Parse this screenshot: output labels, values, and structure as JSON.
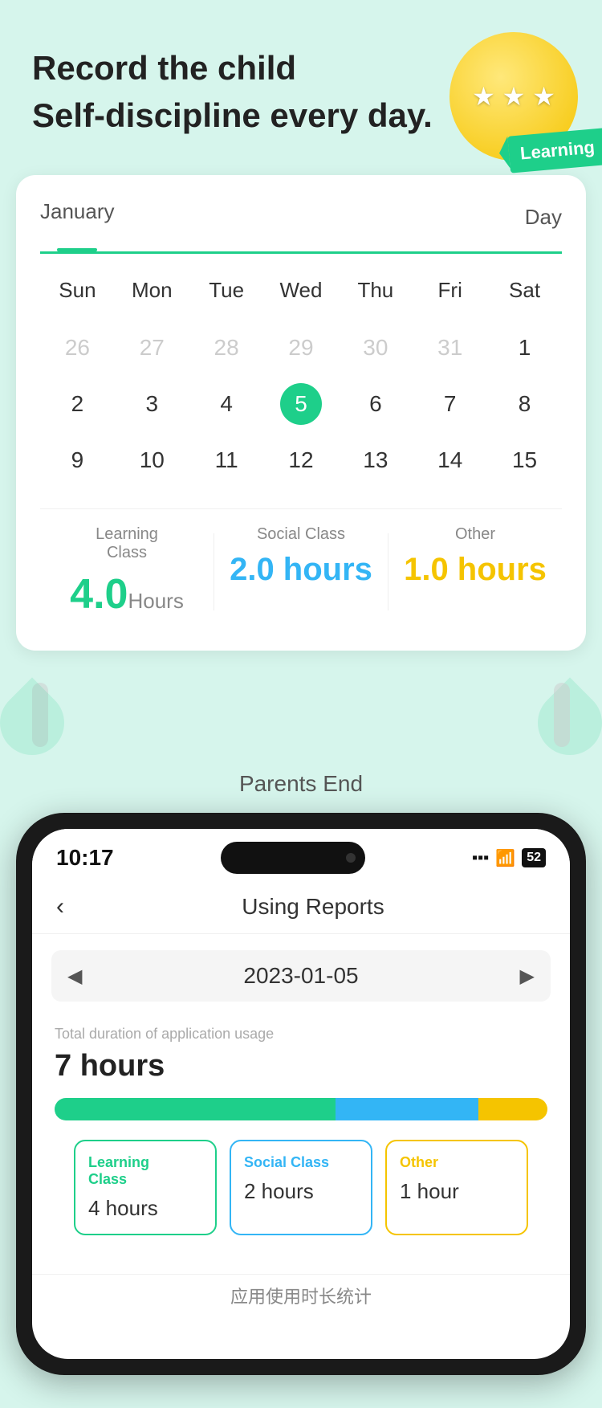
{
  "header": {
    "title_line1": "Record the child",
    "title_line2": "Self-discipline every day.",
    "medal_stars": "★ ★ ★",
    "medal_banner": "Learning"
  },
  "calendar": {
    "month_label": "January",
    "day_label": "Day",
    "weekdays": [
      "Sun",
      "Mon",
      "Tue",
      "Wed",
      "Thu",
      "Fri",
      "Sat"
    ],
    "weeks": [
      [
        {
          "day": "26",
          "type": "prev-month"
        },
        {
          "day": "27",
          "type": "prev-month"
        },
        {
          "day": "28",
          "type": "prev-month"
        },
        {
          "day": "29",
          "type": "prev-month"
        },
        {
          "day": "30",
          "type": "prev-month"
        },
        {
          "day": "31",
          "type": "prev-month"
        },
        {
          "day": "1",
          "type": "current"
        }
      ],
      [
        {
          "day": "2",
          "type": "current"
        },
        {
          "day": "3",
          "type": "current"
        },
        {
          "day": "4",
          "type": "current"
        },
        {
          "day": "5",
          "type": "selected"
        },
        {
          "day": "6",
          "type": "current"
        },
        {
          "day": "7",
          "type": "current"
        },
        {
          "day": "8",
          "type": "current"
        }
      ],
      [
        {
          "day": "9",
          "type": "current"
        },
        {
          "day": "10",
          "type": "current"
        },
        {
          "day": "11",
          "type": "current"
        },
        {
          "day": "12",
          "type": "current"
        },
        {
          "day": "13",
          "type": "current"
        },
        {
          "day": "14",
          "type": "current"
        },
        {
          "day": "15",
          "type": "current"
        }
      ]
    ]
  },
  "stats": {
    "learning_label": "Learning\nClass",
    "learning_value": "4.0",
    "learning_unit": "Hours",
    "social_label": "Social Class",
    "social_value": "2.0 hours",
    "other_label": "Other",
    "other_value": "1.0 hours"
  },
  "parents_end": {
    "label": "Parents End"
  },
  "phone": {
    "status_time": "10:17",
    "battery": "52",
    "nav_title": "Using Reports",
    "nav_back": "‹",
    "date": "2023-01-05",
    "duration_meta": "Total duration of application usage",
    "duration_total": "7 hours",
    "progress": {
      "learning_pct": 57,
      "social_pct": 29,
      "other_pct": 14
    },
    "cards": [
      {
        "label": "Learning Class",
        "value": "4 hours",
        "type": "learning"
      },
      {
        "label": "Social Class",
        "value": "2 hours",
        "type": "social"
      },
      {
        "label": "Other",
        "value": "1 hour",
        "type": "other"
      }
    ],
    "bottom_label": "应用使用时长统计"
  }
}
